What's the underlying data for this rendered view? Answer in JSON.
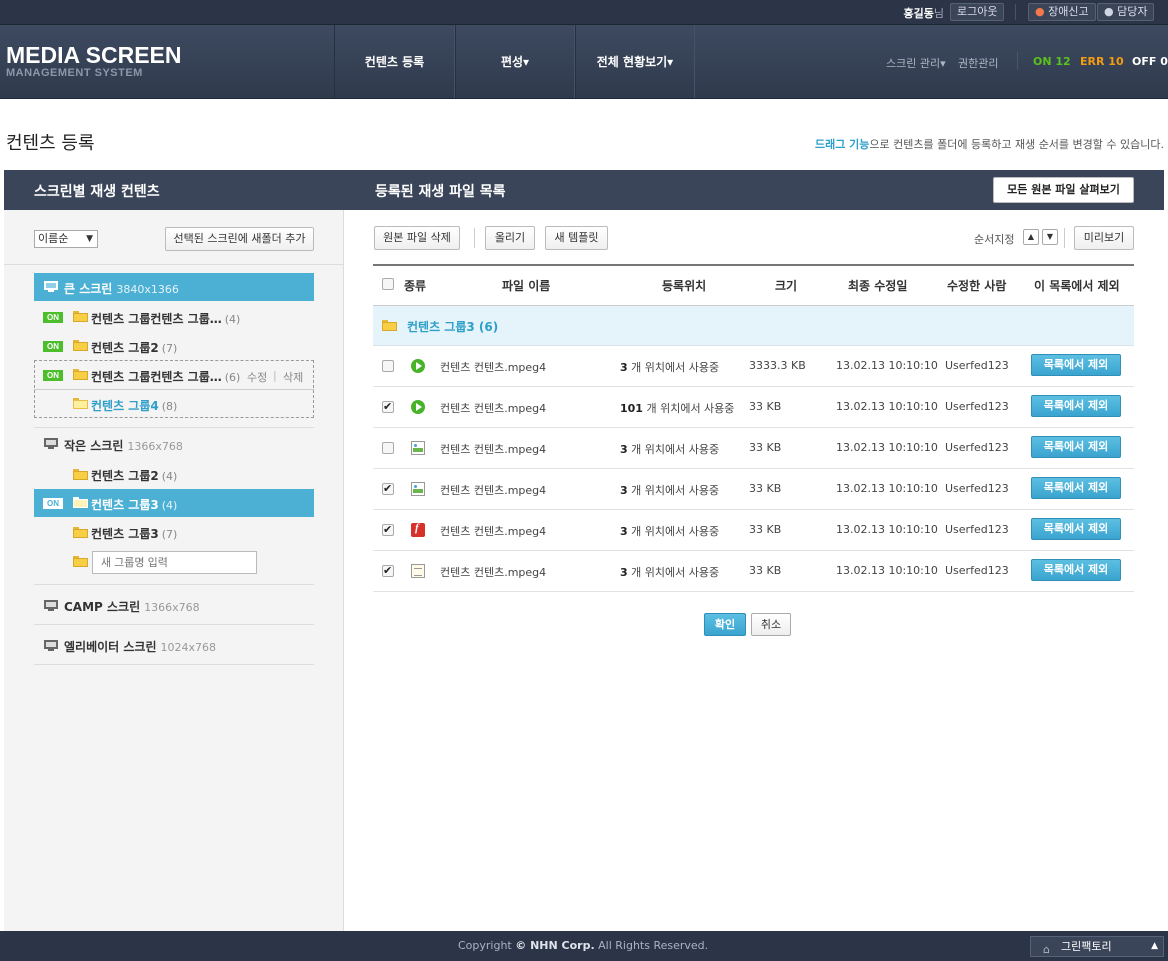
{
  "topbar": {
    "user_name": "홍길동",
    "user_suffix": "님",
    "logout": "로그아웃",
    "report": "장애신고",
    "manager": "담당자"
  },
  "brand": {
    "logo_main": "MEDIA SCREEN",
    "logo_sub": "MANAGEMENT SYSTEM"
  },
  "nav": {
    "items": [
      "컨텐츠 등록",
      "편성▾",
      "전체 현황보기▾"
    ],
    "screen_mgmt": "스크린 관리▾",
    "permission": "권한관리",
    "status": {
      "on": "ON 12",
      "err": "ERR 10",
      "off": "OFF 0"
    },
    "colors": {
      "on": "#5ac21e",
      "err": "#f39c12",
      "off": "#ffffff"
    }
  },
  "page": {
    "title": "컨텐츠 등록",
    "desc_highlight": "드래그 기능",
    "desc_rest": "으로 컨텐츠를 폴더에 등록하고 재생 순서를 변경할 수 있습니다."
  },
  "panel": {
    "left_title": "스크린별 재생 컨텐츠",
    "right_title": "등록된 재생 파일 목록",
    "view_all_button": "모든 원본 파일 살펴보기"
  },
  "left": {
    "sort_select": "이름순",
    "add_folder_button": "선택된 스크린에 새폴더 추가",
    "screens": [
      {
        "name": "큰 스크린",
        "res": "3840x1366"
      },
      {
        "name": "작은 스크린",
        "res": "1366x768"
      },
      {
        "name": "CAMP 스크린",
        "res": "1366x768"
      },
      {
        "name": "엘리베이터 스크린",
        "res": "1024x768"
      }
    ],
    "on_label": "ON",
    "groups": [
      {
        "name": "컨텐츠 그룹컨텐츠 그룹…",
        "count": "(4)"
      },
      {
        "name": "컨텐츠 그룹2",
        "count": "(7)"
      },
      {
        "name": "컨텐츠 그룹컨텐츠 그룹…",
        "count": "(6)"
      },
      {
        "name": "컨텐츠 그룹4",
        "count": "(8)"
      },
      {
        "name": "컨텐츠 그룹2",
        "count": "(4)"
      },
      {
        "name": "컨텐츠 그룹3",
        "count": "(4)"
      },
      {
        "name": "컨텐츠 그룹3",
        "count": "(7)"
      }
    ],
    "edit": "수정",
    "edit_sep": "|",
    "delete": "삭제",
    "new_group_placeholder": "새 그룹명 입력"
  },
  "right": {
    "toolbar": {
      "delete_original": "원본 파일 삭제",
      "upload": "올리기",
      "new_template": "새 템플릿",
      "order_label": "순서지정",
      "preview": "미리보기",
      "up": "▲",
      "down": "▼"
    },
    "columns": [
      "종류",
      "파일 이름",
      "등록위치",
      "크기",
      "최종 수정일",
      "수정한 사람",
      "이 목록에서 제외"
    ],
    "folder_row": "컨텐츠 그룹3 (6)",
    "rows": [
      {
        "type": "video",
        "checked": false,
        "name": "컨텐츠 컨텐츠.mpeg4",
        "loc_num": "3",
        "loc_text": " 개 위치에서 사용중",
        "size": "3333.3 KB",
        "date": "13.02.13 10:10:10",
        "user": "Userfed123"
      },
      {
        "type": "video",
        "checked": true,
        "name": "컨텐츠 컨텐츠.mpeg4",
        "loc_num": "101",
        "loc_text": " 개 위치에서 사용중",
        "size": "33 KB",
        "date": "13.02.13 10:10:10",
        "user": "Userfed123"
      },
      {
        "type": "image",
        "checked": false,
        "name": "컨텐츠 컨텐츠.mpeg4",
        "loc_num": "3",
        "loc_text": " 개 위치에서 사용중",
        "size": "33 KB",
        "date": "13.02.13 10:10:10",
        "user": "Userfed123"
      },
      {
        "type": "image",
        "checked": true,
        "name": "컨텐츠 컨텐츠.mpeg4",
        "loc_num": "3",
        "loc_text": " 개 위치에서 사용중",
        "size": "33 KB",
        "date": "13.02.13 10:10:10",
        "user": "Userfed123"
      },
      {
        "type": "flash",
        "checked": true,
        "name": "컨텐츠 컨텐츠.mpeg4",
        "loc_num": "3",
        "loc_text": " 개 위치에서 사용중",
        "size": "33 KB",
        "date": "13.02.13 10:10:10",
        "user": "Userfed123"
      },
      {
        "type": "document",
        "checked": true,
        "name": "컨텐츠 컨텐츠.mpeg4",
        "loc_num": "3",
        "loc_text": " 개 위치에서 사용중",
        "size": "33 KB",
        "date": "13.02.13 10:10:10",
        "user": "Userfed123"
      }
    ],
    "exclude_button": "목록에서 제외",
    "ok": "확인",
    "cancel": "취소"
  },
  "footer": {
    "copyright_pre": "Copyright ",
    "copyright_mark": "© NHN Corp.",
    "copyright_post": " All Rights Reserved.",
    "family_site": "그린팩토리",
    "family_arrow": "▲"
  }
}
